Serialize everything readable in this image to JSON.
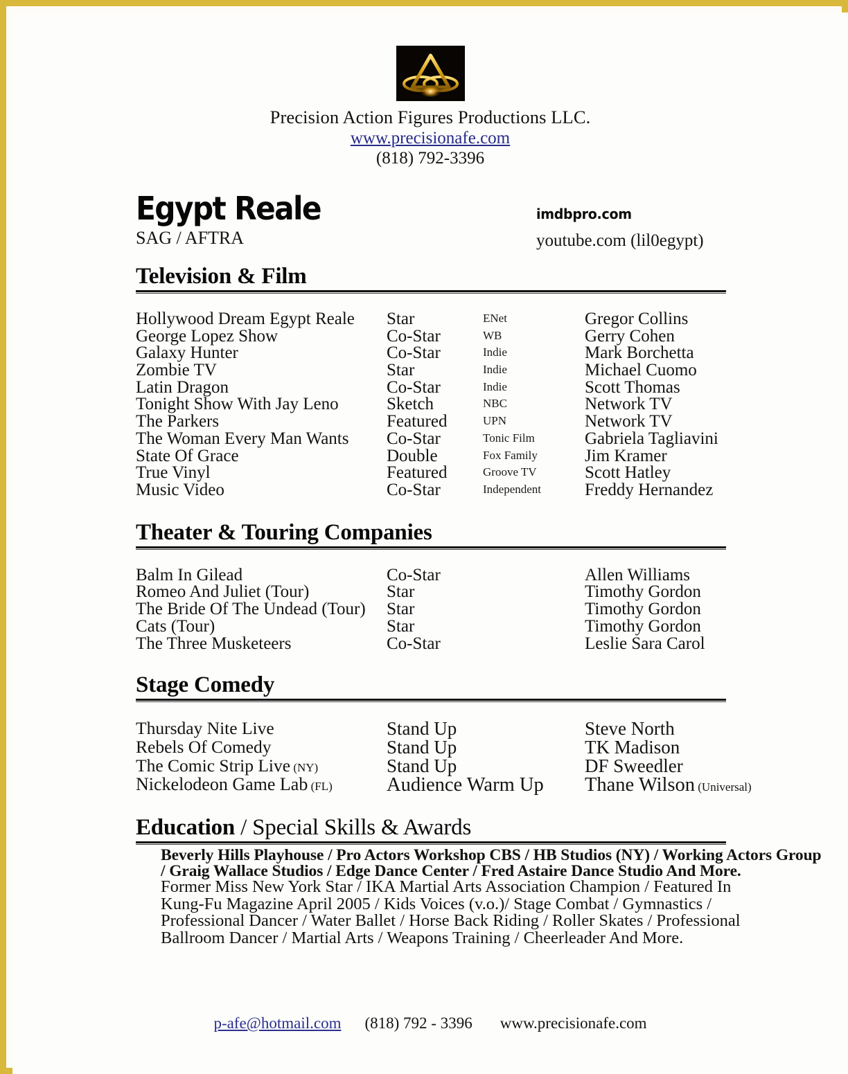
{
  "page": {
    "border_color": "#d8b93b",
    "background": "#fdfdfb"
  },
  "header": {
    "logo_icon": "gold-triangle-rings-logo",
    "company": "Precision Action Figures Productions LLC.",
    "website": "www.precisionafe.com",
    "phone": "(818) 792-3396"
  },
  "identity": {
    "name": "Egypt Reale",
    "union": "SAG / AFTRA",
    "imdb": "imdbpro.com",
    "youtube": "youtube.com (lil0egypt)"
  },
  "sections": {
    "tv": {
      "heading": "Television & Film",
      "rows": [
        {
          "title": "Hollywood Dream Egypt Reale",
          "role": "Star",
          "network": "ENet",
          "director": "Gregor Collins"
        },
        {
          "title": "George Lopez Show",
          "role": "Co-Star",
          "network": "WB",
          "director": "Gerry Cohen"
        },
        {
          "title": "Galaxy Hunter",
          "role": "Co-Star",
          "network": "Indie",
          "director": "Mark Borchetta"
        },
        {
          "title": "Zombie TV",
          "role": "Star",
          "network": "Indie",
          "director": "Michael Cuomo"
        },
        {
          "title": "Latin Dragon",
          "role": "Co-Star",
          "network": "Indie",
          "director": "Scott Thomas"
        },
        {
          "title": "Tonight Show With Jay Leno",
          "role": "Sketch",
          "network": "NBC",
          "director": "Network TV"
        },
        {
          "title": "The Parkers",
          "role": "Featured",
          "network": "UPN",
          "director": "Network TV"
        },
        {
          "title": "The Woman Every Man Wants",
          "role": "Co-Star",
          "network": "Tonic Film",
          "director": "Gabriela Tagliavini"
        },
        {
          "title": "State Of Grace",
          "role": "Double",
          "network": "Fox Family",
          "director": "Jim Kramer"
        },
        {
          "title": "True Vinyl",
          "role": "Featured",
          "network": "Groove TV",
          "director": "Scott Hatley"
        },
        {
          "title": "Music Video",
          "role": "Co-Star",
          "network": "Independent",
          "director": "Freddy Hernandez"
        }
      ]
    },
    "theater": {
      "heading": "Theater & Touring Companies",
      "rows": [
        {
          "title": "Balm In Gilead",
          "role": "Co-Star",
          "director": "Allen Williams"
        },
        {
          "title": "Romeo And Juliet (Tour)",
          "role": "Star",
          "director": "Timothy Gordon"
        },
        {
          "title": "The Bride Of The Undead (Tour)",
          "role": "Star",
          "director": "Timothy Gordon"
        },
        {
          "title": "Cats (Tour)",
          "role": "Star",
          "director": "Timothy Gordon"
        },
        {
          "title": "The Three Musketeers",
          "role": "Co-Star",
          "director": "Leslie Sara Carol"
        }
      ]
    },
    "comedy": {
      "heading": "Stage Comedy",
      "rows": [
        {
          "title": "Thursday Nite Live",
          "title_note": "",
          "role": "Stand Up",
          "director": "Steve North",
          "director_note": ""
        },
        {
          "title": "Rebels Of Comedy",
          "title_note": "",
          "role": "Stand Up",
          "director": "TK Madison",
          "director_note": ""
        },
        {
          "title": "The Comic Strip Live",
          "title_note": "(NY)",
          "role": "Stand Up",
          "director": "DF Sweedler",
          "director_note": ""
        },
        {
          "title": "Nickelodeon Game Lab",
          "title_note": "(FL)",
          "role": "Audience Warm Up",
          "director": "Thane Wilson",
          "director_note": "(Universal)"
        }
      ]
    },
    "education": {
      "heading_bold": "Education",
      "heading_light": " / Special Skills & Awards",
      "lines": [
        {
          "text": "Beverly Hills Playhouse / Pro Actors Workshop CBS / HB Studios (NY) / Working Actors Group",
          "bold": true
        },
        {
          "text": "/ Graig Wallace Studios / Edge Dance Center /   Fred Astaire Dance Studio And More.",
          "bold": true
        },
        {
          "text": "Former Miss New York Star / IKA Martial Arts Association Champion / Featured In",
          "bold": false
        },
        {
          "text": "Kung-Fu Magazine April 2005 / Kids Voices (v.o.)/ Stage Combat / Gymnastics /",
          "bold": false
        },
        {
          "text": "Professional Dancer / Water Ballet / Horse Back Riding / Roller Skates / Professional",
          "bold": false
        },
        {
          "text": "Ballroom Dancer / Martial Arts / Weapons Training / Cheerleader And More.",
          "bold": false
        }
      ]
    }
  },
  "footer": {
    "email": "p-afe@hotmail.com",
    "phone": "(818) 792 - 3396",
    "website": "www.precisionafe.com"
  }
}
